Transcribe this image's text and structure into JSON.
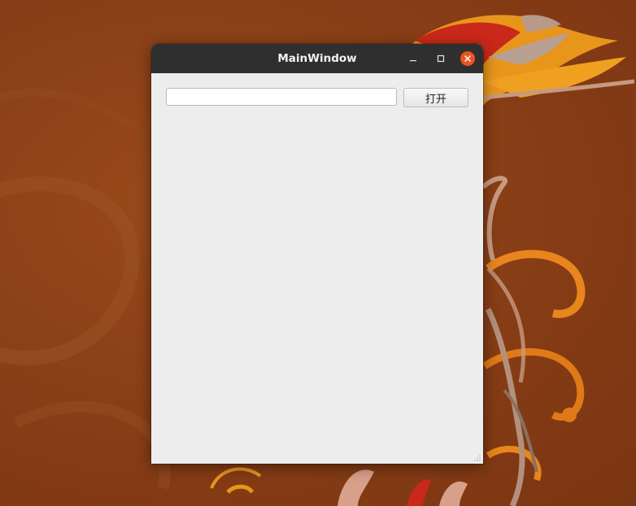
{
  "window": {
    "title": "MainWindow"
  },
  "toolbar": {
    "path_input_value": "",
    "open_button_label": "打开"
  },
  "colors": {
    "accent_close": "#e95420",
    "titlebar": "#2f2f2f",
    "client_bg": "#ededed",
    "desktop_bg": "#8a3f16"
  },
  "icons": {
    "minimize": "minimize-icon",
    "maximize": "maximize-icon",
    "close": "close-icon",
    "size_grip": "resize-grip-icon"
  }
}
